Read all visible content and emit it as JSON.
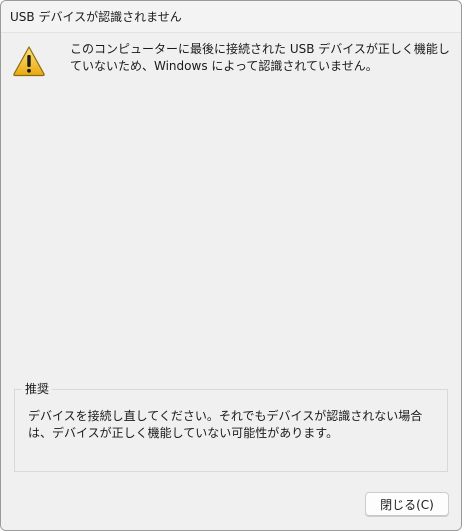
{
  "window": {
    "title": "USB デバイスが認識されません"
  },
  "message": {
    "icon": "warning-icon",
    "text": "このコンピューターに最後に接続された USB デバイスが正しく機能していないため、Windows によって認識されていません。"
  },
  "recommendation": {
    "heading": "推奨",
    "text": "デバイスを接続し直してください。それでもデバイスが認識されない場合は、デバイスが正しく機能していない可能性があります。"
  },
  "buttons": {
    "close_label": "閉じる(C)"
  },
  "colors": {
    "warning_fill": "#f5c230",
    "warning_stroke": "#8a6a10",
    "window_background": "#f0f0f0"
  }
}
